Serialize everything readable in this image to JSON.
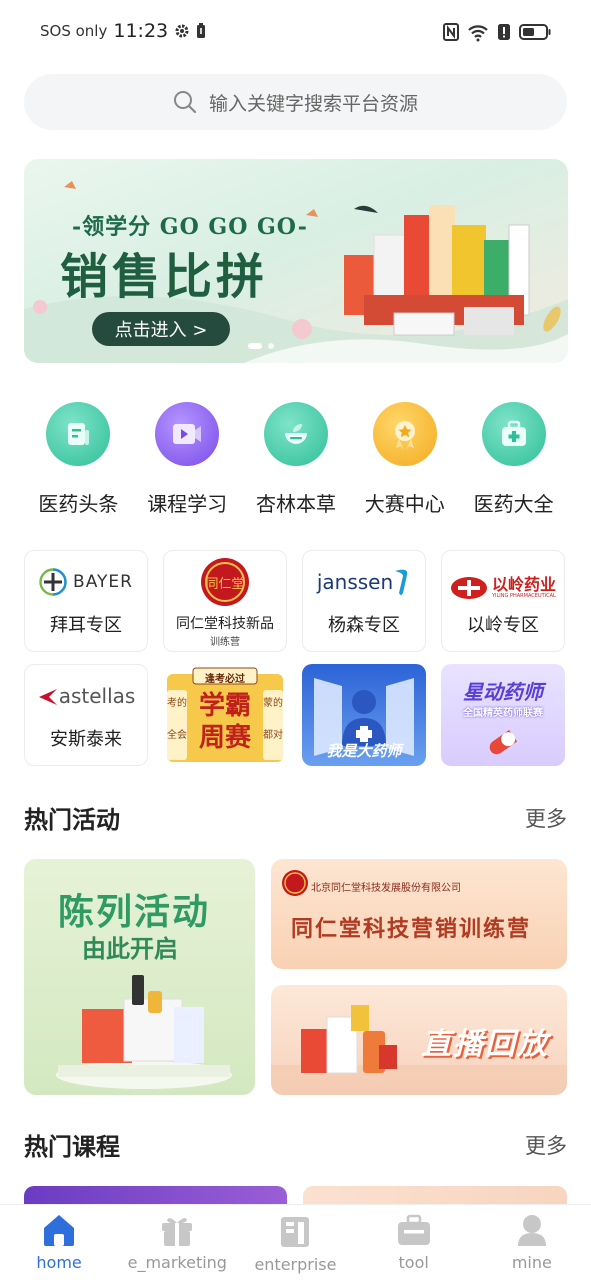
{
  "status_bar": {
    "carrier": "SOS only",
    "time": "11:23"
  },
  "search": {
    "placeholder": "输入关键字搜索平台资源"
  },
  "banner": {
    "subtitle": "-领学分 GO GO GO-",
    "title": "销售比拼",
    "cta": "点击进入 >"
  },
  "quick_nav": [
    {
      "label": "医药头条",
      "icon": "news-icon",
      "color": "#3ec9a8"
    },
    {
      "label": "课程学习",
      "icon": "video-icon",
      "color": "#8a5cf0"
    },
    {
      "label": "杏林本草",
      "icon": "herb-bowl-icon",
      "color": "#3ec9a8"
    },
    {
      "label": "大赛中心",
      "icon": "medal-icon",
      "color": "#f6b92b"
    },
    {
      "label": "医药大全",
      "icon": "medical-kit-icon",
      "color": "#3ec9a8"
    }
  ],
  "partners": [
    {
      "logo": "BAYER",
      "label": "拜耳专区"
    },
    {
      "logo": "同仁堂",
      "label": "同仁堂科技新品",
      "sub": "训练营"
    },
    {
      "logo": "janssen",
      "label": "杨森专区"
    },
    {
      "logo": "以岭药业",
      "logo_sub": "YILING PHARMACEUTICAL",
      "label": "以岭专区"
    },
    {
      "logo": "astellas",
      "label": "安斯泰来"
    },
    {
      "top": "逢考必过",
      "title": "学霸周赛",
      "side_left": "考的",
      "side_left2": "全会",
      "side_right": "蒙的",
      "side_right2": "都对"
    },
    {
      "title": "我是大药师"
    },
    {
      "title": "星动药师",
      "subtitle": "全国精英药师联赛"
    }
  ],
  "hot_activities": {
    "title": "热门活动",
    "more": "更多",
    "big": {
      "line1": "陈列活动",
      "line2": "由此开启"
    },
    "card1": {
      "company": "北京同仁堂科技发展股份有限公司",
      "title": "同仁堂科技营销训练营"
    },
    "card2": {
      "title": "直播回放"
    }
  },
  "hot_courses": {
    "title": "热门课程",
    "more": "更多"
  },
  "tabs": [
    {
      "label": "home",
      "icon": "home-icon",
      "active": true
    },
    {
      "label": "e_marketing",
      "icon": "gift-icon",
      "active": false
    },
    {
      "label": "enterprise",
      "icon": "building-icon",
      "active": false
    },
    {
      "label": "tool",
      "icon": "toolbox-icon",
      "active": false
    },
    {
      "label": "mine",
      "icon": "user-icon",
      "active": false
    }
  ],
  "colors": {
    "accent": "#2f6fdc",
    "tab_inactive": "#999999"
  }
}
